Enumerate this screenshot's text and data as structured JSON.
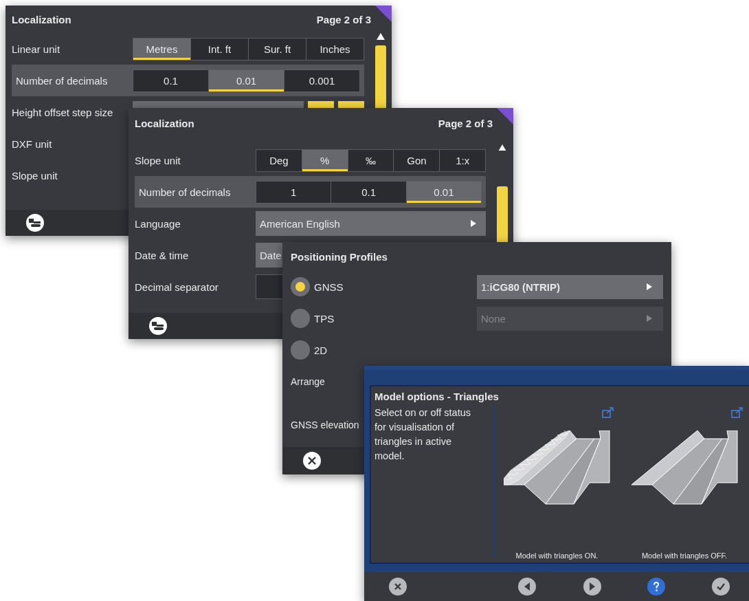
{
  "localization_back": {
    "title": "Localization",
    "page": "Page 2 of 3",
    "rows": [
      {
        "kind": "segmented",
        "label": "Linear unit",
        "highlighted": false,
        "options": [
          {
            "label": "Metres",
            "selected": true
          },
          {
            "label": "Int. ft",
            "selected": false
          },
          {
            "label": "Sur. ft",
            "selected": false
          },
          {
            "label": "Inches",
            "selected": false
          }
        ]
      },
      {
        "kind": "segmented",
        "label": "Number of decimals",
        "highlighted": true,
        "options": [
          {
            "label": "0.1",
            "selected": false
          },
          {
            "label": "0.01",
            "selected": true
          },
          {
            "label": "0.001",
            "selected": false
          }
        ]
      },
      {
        "kind": "stepper",
        "label": "Height offset step size",
        "highlighted": false
      },
      {
        "kind": "label",
        "label": "DXF unit",
        "highlighted": false
      },
      {
        "kind": "label",
        "label": "Slope unit",
        "highlighted": false
      }
    ]
  },
  "localization_front": {
    "title": "Localization",
    "page": "Page 2 of 3",
    "rows": [
      {
        "kind": "segmented",
        "label": "Slope unit",
        "highlighted": false,
        "options": [
          {
            "label": "Deg",
            "selected": false
          },
          {
            "label": "%",
            "selected": true
          },
          {
            "label": "‰",
            "selected": false
          },
          {
            "label": "Gon",
            "selected": false
          },
          {
            "label": "1:x",
            "selected": false
          }
        ]
      },
      {
        "kind": "segmented",
        "label": "Number of decimals",
        "highlighted": true,
        "options": [
          {
            "label": "1",
            "selected": false
          },
          {
            "label": "0.1",
            "selected": false
          },
          {
            "label": "0.01",
            "selected": true
          }
        ]
      },
      {
        "kind": "dropdown",
        "label": "Language",
        "value": "American English",
        "highlighted": false
      },
      {
        "kind": "dropdown",
        "label": "Date & time",
        "value": "Date",
        "highlighted": false
      },
      {
        "kind": "field",
        "label": "Decimal separator",
        "highlighted": false
      }
    ]
  },
  "positioning_profiles": {
    "title": "Positioning Profiles",
    "profiles": [
      {
        "label": "GNSS",
        "selected": true,
        "source": {
          "value": "1:**iCG80 (NTRIP)**",
          "disabled": false
        }
      },
      {
        "label": "TPS",
        "selected": false,
        "source": {
          "value": "None",
          "disabled": true
        }
      },
      {
        "label": "2D",
        "selected": false
      }
    ],
    "settings": [
      "Arrange",
      "GNSS elevation"
    ]
  },
  "model_options": {
    "title": "Model options - Triangles",
    "description": "Select on or off status for visualisation of triangles in active model.",
    "previews": [
      {
        "caption": "Model with triangles ON.",
        "triangles": true
      },
      {
        "caption": "Model with triangles OFF.",
        "triangles": false
      }
    ],
    "toolbar": [
      {
        "kind": "close",
        "selected": false
      },
      {
        "kind": "previous",
        "selected": false
      },
      {
        "kind": "next",
        "selected": false
      },
      {
        "kind": "help",
        "selected": true
      },
      {
        "kind": "confirm",
        "selected": false
      }
    ]
  }
}
